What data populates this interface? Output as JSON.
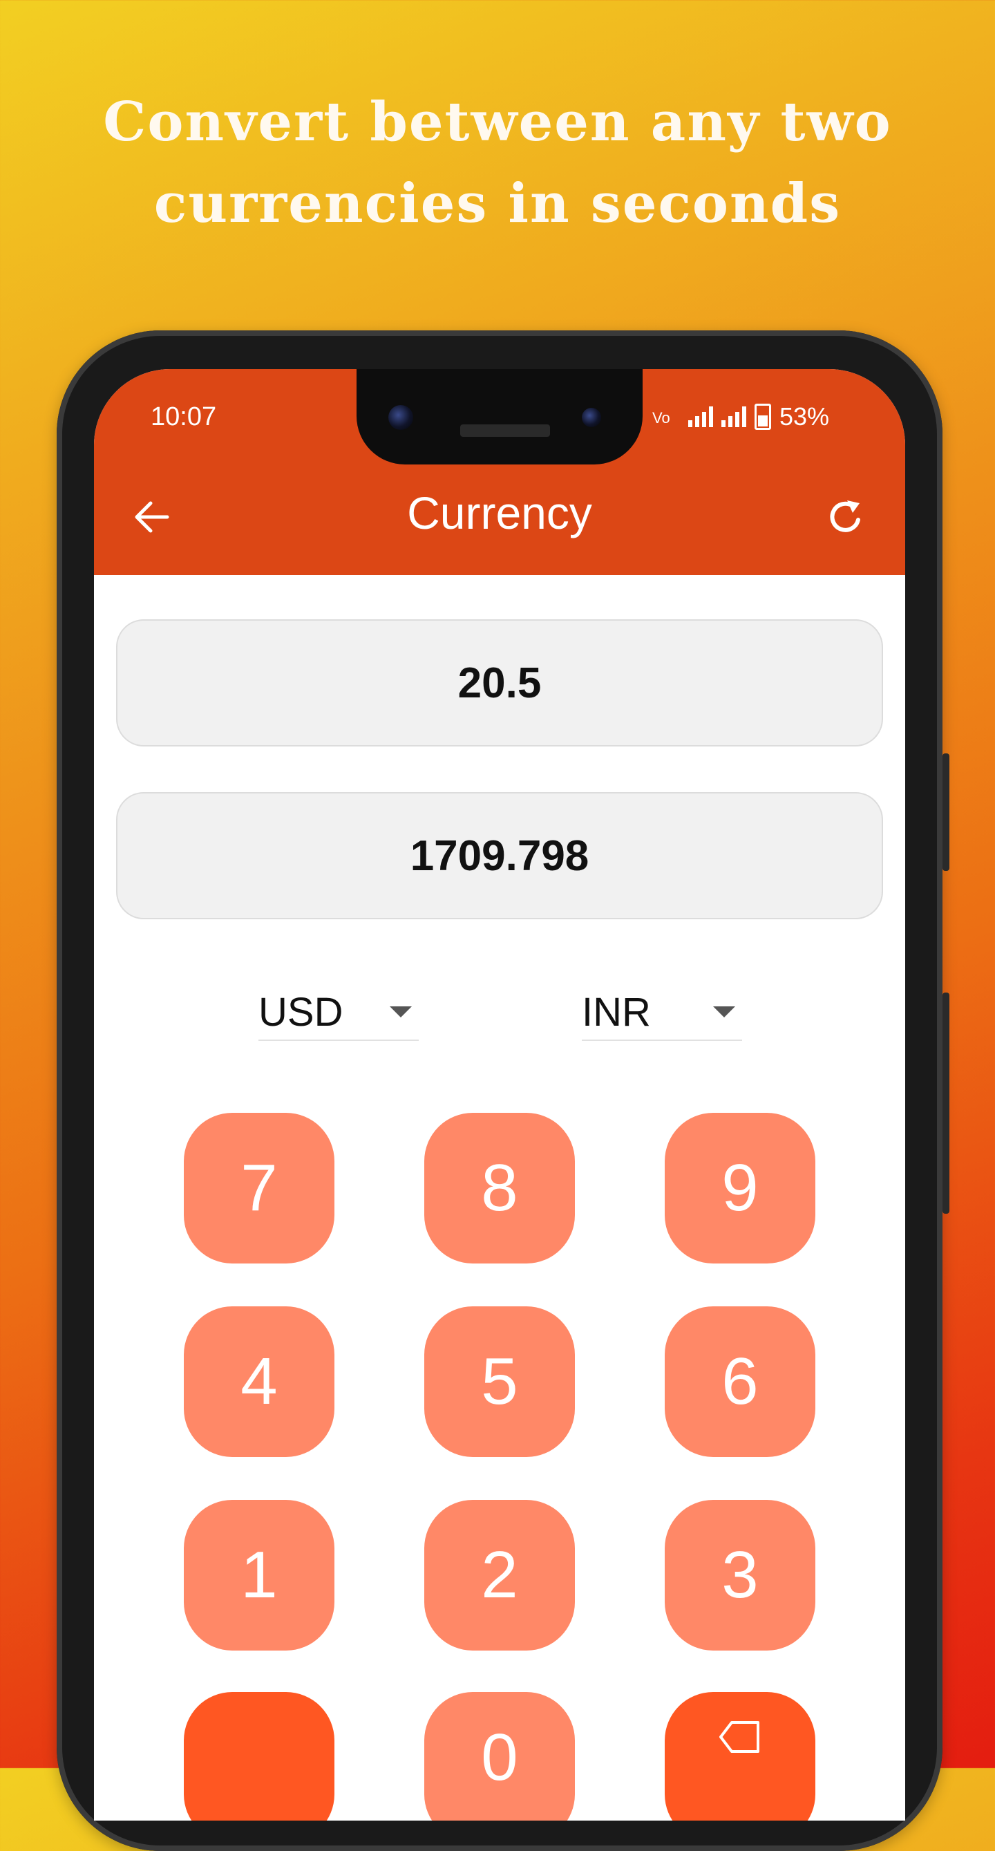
{
  "promo": {
    "line1": "Convert between any two",
    "line2": "currencies in seconds"
  },
  "status_bar": {
    "time": "10:07",
    "battery": "53%"
  },
  "app_bar": {
    "title": "Currency"
  },
  "converter": {
    "input_value": "20.5",
    "output_value": "1709.798",
    "from_currency": "USD",
    "to_currency": "INR"
  },
  "keypad": {
    "row1": [
      "7",
      "8",
      "9"
    ],
    "row2": [
      "4",
      "5",
      "6"
    ],
    "row3": [
      "1",
      "2",
      "3"
    ],
    "row4_middle": "0"
  },
  "colors": {
    "app_bar": "#dc4715",
    "key": "#ff8867",
    "key_accent": "#ff5722"
  }
}
